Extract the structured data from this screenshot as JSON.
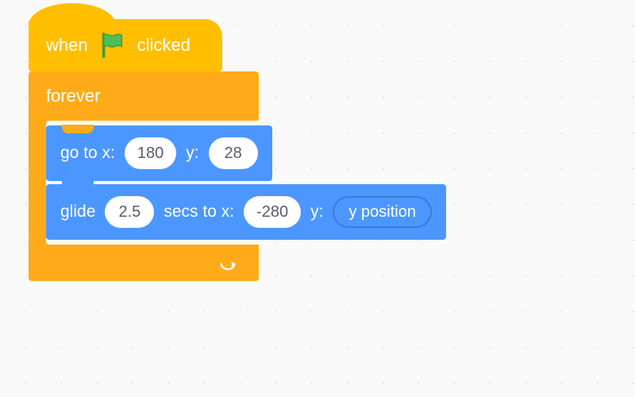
{
  "hat": {
    "prefix": "when",
    "suffix": "clicked",
    "icon": "green-flag"
  },
  "forever": {
    "label": "forever"
  },
  "goto": {
    "label_x": "go to x:",
    "x_value": "180",
    "label_y": "y:",
    "y_value": "28"
  },
  "glide": {
    "label_glide": "glide",
    "secs_value": "2.5",
    "label_secs_to_x": "secs to x:",
    "x_value": "-280",
    "label_y": "y:",
    "y_reporter": "y position"
  },
  "colors": {
    "events": "#ffbf00",
    "control": "#ffab19",
    "motion": "#4c97ff"
  }
}
